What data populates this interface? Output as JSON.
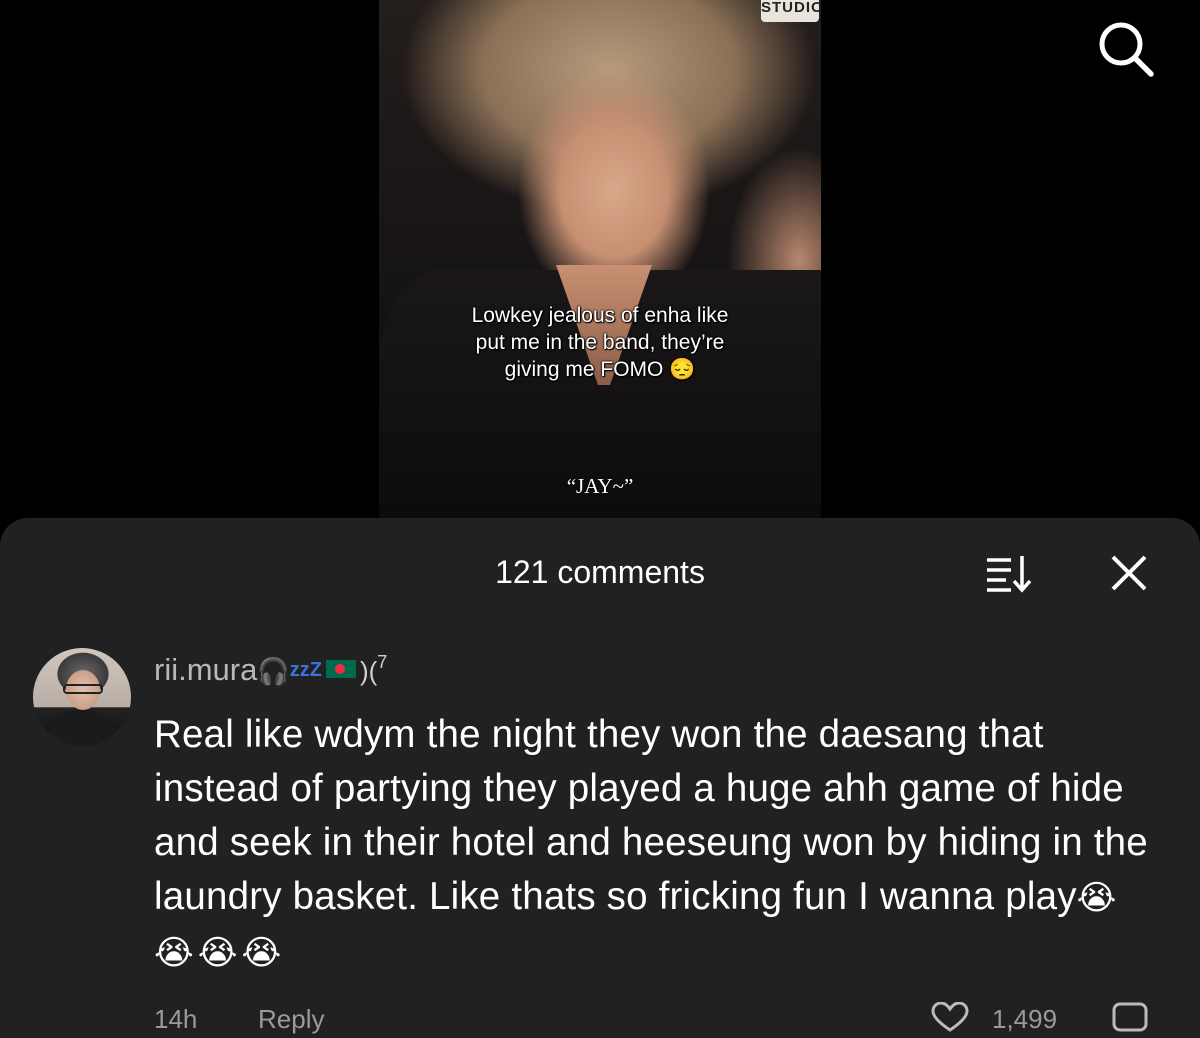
{
  "video": {
    "watermark": "STUDIO",
    "caption_lines": [
      "Lowkey jealous of enha like",
      "put me in the band, they’re",
      "giving me FOMO 😔"
    ],
    "subtitle": "“JAY~”"
  },
  "header": {
    "search_icon": "search-icon"
  },
  "comments_sheet": {
    "title": "121 comments",
    "sort_icon": "sort-icon",
    "close_icon": "close-icon",
    "comment": {
      "username": "rii.mura",
      "username_decorations": {
        "headphones": "🎧",
        "zz": "zzZ",
        "flag": "bangladesh-flag",
        "tail": ")(",
        "superscript": "7"
      },
      "text": "Real like wdym the night they won the daesang that instead of partying they played a huge ahh game of hide and seek in their hotel and heeseung won by hiding in the laundry basket. Like thats so fricking fun I wanna play",
      "emojis": "😭😭😭😭",
      "time": "14h",
      "reply_label": "Reply",
      "like_count": "1,499"
    }
  },
  "colors": {
    "background": "#000000",
    "sheet": "#212121",
    "text_primary": "#ffffff",
    "text_secondary": "#b8b8b8"
  }
}
